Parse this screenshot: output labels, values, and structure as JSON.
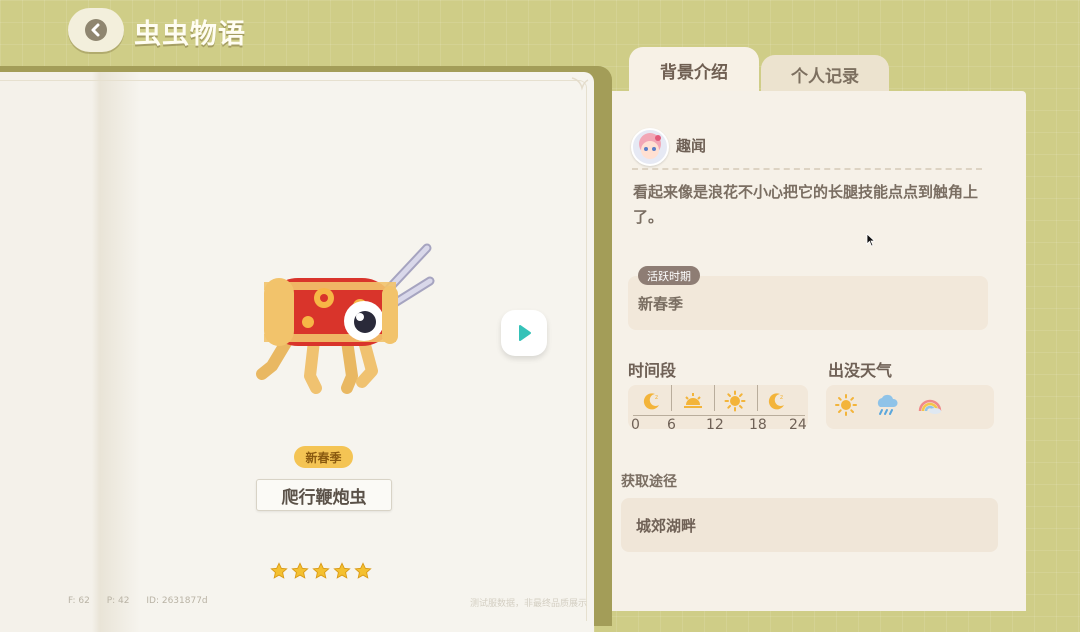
{
  "header": {
    "title": "虫虫物语",
    "back_icon": "chevron-left-icon"
  },
  "tabs": [
    {
      "label": "背景介绍",
      "active": true
    },
    {
      "label": "个人记录",
      "active": false
    }
  ],
  "bug": {
    "season_badge": "新春季",
    "name": "爬行鞭炮虫",
    "rarity_stars": 5,
    "next_icon": "play-right-icon"
  },
  "info": {
    "trivia_label": "趣闻",
    "trivia_text": "看起来像是浪花不小心把它的长腿技能点点到触角上了。",
    "active_period_tag": "活跃时期",
    "active_period_value": "新春季",
    "time_label": "时间段",
    "time_ticks": [
      "0",
      "6",
      "12",
      "18",
      "24"
    ],
    "time_icons": [
      "moon-icon",
      "sunrise-icon",
      "sun-icon",
      "moon-icon"
    ],
    "weather_label": "出没天气",
    "weather_icons": [
      "sunny-icon",
      "rain-icon",
      "rainbow-icon"
    ],
    "source_label": "获取途径",
    "source_value": "城郊湖畔"
  },
  "debug": {
    "f": "F: 62",
    "p": "P: 42",
    "id": "ID: 2631877d"
  },
  "watermark": "测试服数据，非最终品质展示",
  "colors": {
    "background": "#cfcd87",
    "panel": "#f6f1e8",
    "accent": "#35c2b8",
    "star": "#f4c030"
  }
}
